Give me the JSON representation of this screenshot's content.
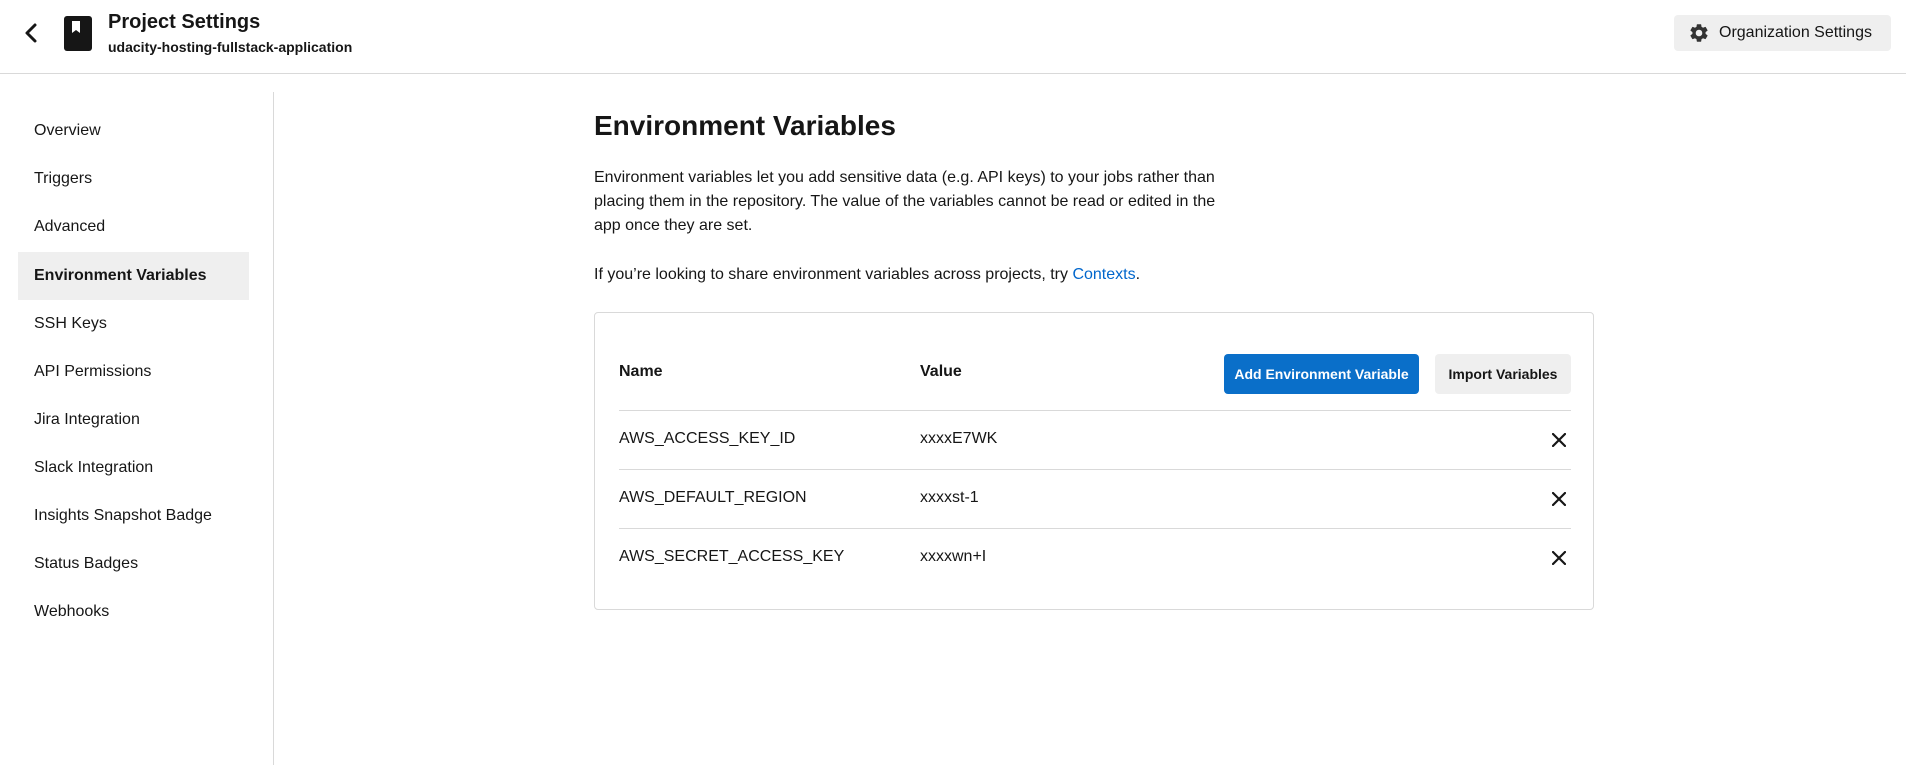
{
  "header": {
    "title": "Project Settings",
    "subtitle": "udacity-hosting-fullstack-application",
    "org_button_label": "Organization Settings"
  },
  "sidebar": {
    "items": [
      {
        "label": "Overview",
        "active": false
      },
      {
        "label": "Triggers",
        "active": false
      },
      {
        "label": "Advanced",
        "active": false
      },
      {
        "label": "Environment Variables",
        "active": true
      },
      {
        "label": "SSH Keys",
        "active": false
      },
      {
        "label": "API Permissions",
        "active": false
      },
      {
        "label": "Jira Integration",
        "active": false
      },
      {
        "label": "Slack Integration",
        "active": false
      },
      {
        "label": "Insights Snapshot Badge",
        "active": false
      },
      {
        "label": "Status Badges",
        "active": false
      },
      {
        "label": "Webhooks",
        "active": false
      }
    ]
  },
  "main": {
    "heading": "Environment Variables",
    "description": "Environment variables let you add sensitive data (e.g. API keys) to your jobs rather than placing them in the repository. The value of the variables cannot be read or edited in the app once they are set.",
    "contexts_prefix": "If you’re looking to share environment variables across projects, try ",
    "contexts_link": "Contexts",
    "contexts_suffix": ".",
    "table": {
      "col_name": "Name",
      "col_value": "Value",
      "add_button": "Add Environment Variable",
      "import_button": "Import Variables",
      "rows": [
        {
          "name": "AWS_ACCESS_KEY_ID",
          "value": "xxxxE7WK"
        },
        {
          "name": "AWS_DEFAULT_REGION",
          "value": "xxxxst-1"
        },
        {
          "name": "AWS_SECRET_ACCESS_KEY",
          "value": "xxxxwn+I"
        }
      ]
    }
  },
  "colors": {
    "accent": "#0a6fc9",
    "link": "#0066cc",
    "active_nav_bg": "#efefef",
    "border": "#d9d9d9"
  },
  "icons": {
    "back": "chevron-left-icon",
    "project": "bookmark-icon",
    "settings": "gear-icon",
    "delete": "close-icon"
  }
}
